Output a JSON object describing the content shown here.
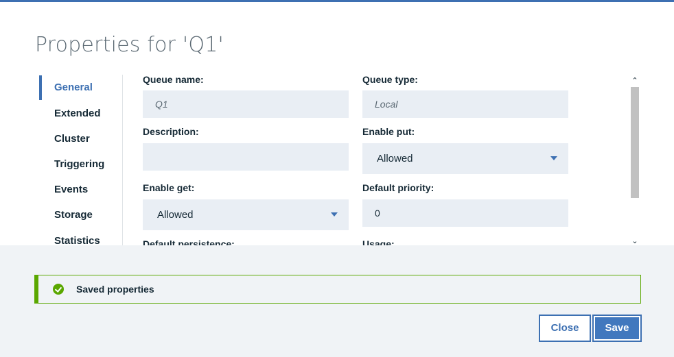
{
  "dialog": {
    "title": "Properties for 'Q1'"
  },
  "nav": {
    "items": [
      {
        "label": "General",
        "active": true
      },
      {
        "label": "Extended",
        "active": false
      },
      {
        "label": "Cluster",
        "active": false
      },
      {
        "label": "Triggering",
        "active": false
      },
      {
        "label": "Events",
        "active": false
      },
      {
        "label": "Storage",
        "active": false
      },
      {
        "label": "Statistics",
        "active": false
      }
    ]
  },
  "form": {
    "queue_name": {
      "label": "Queue name:",
      "value": "Q1"
    },
    "queue_type": {
      "label": "Queue type:",
      "value": "Local"
    },
    "description": {
      "label": "Description:",
      "value": ""
    },
    "enable_put": {
      "label": "Enable put:",
      "value": "Allowed"
    },
    "enable_get": {
      "label": "Enable get:",
      "value": "Allowed"
    },
    "default_priority": {
      "label": "Default priority:",
      "value": "0"
    },
    "default_persistence": {
      "label": "Default persistence:"
    },
    "usage": {
      "label": "Usage:"
    }
  },
  "scrollbar": {
    "up_glyph": "⌃",
    "down_glyph": "⌄"
  },
  "notification": {
    "text": "Saved properties",
    "status": "success",
    "color": "#5aa700"
  },
  "buttons": {
    "close": "Close",
    "save": "Save"
  },
  "colors": {
    "accent": "#3d70b2",
    "field_bg": "#e9eef4",
    "footer_bg": "#f0f3f6"
  }
}
